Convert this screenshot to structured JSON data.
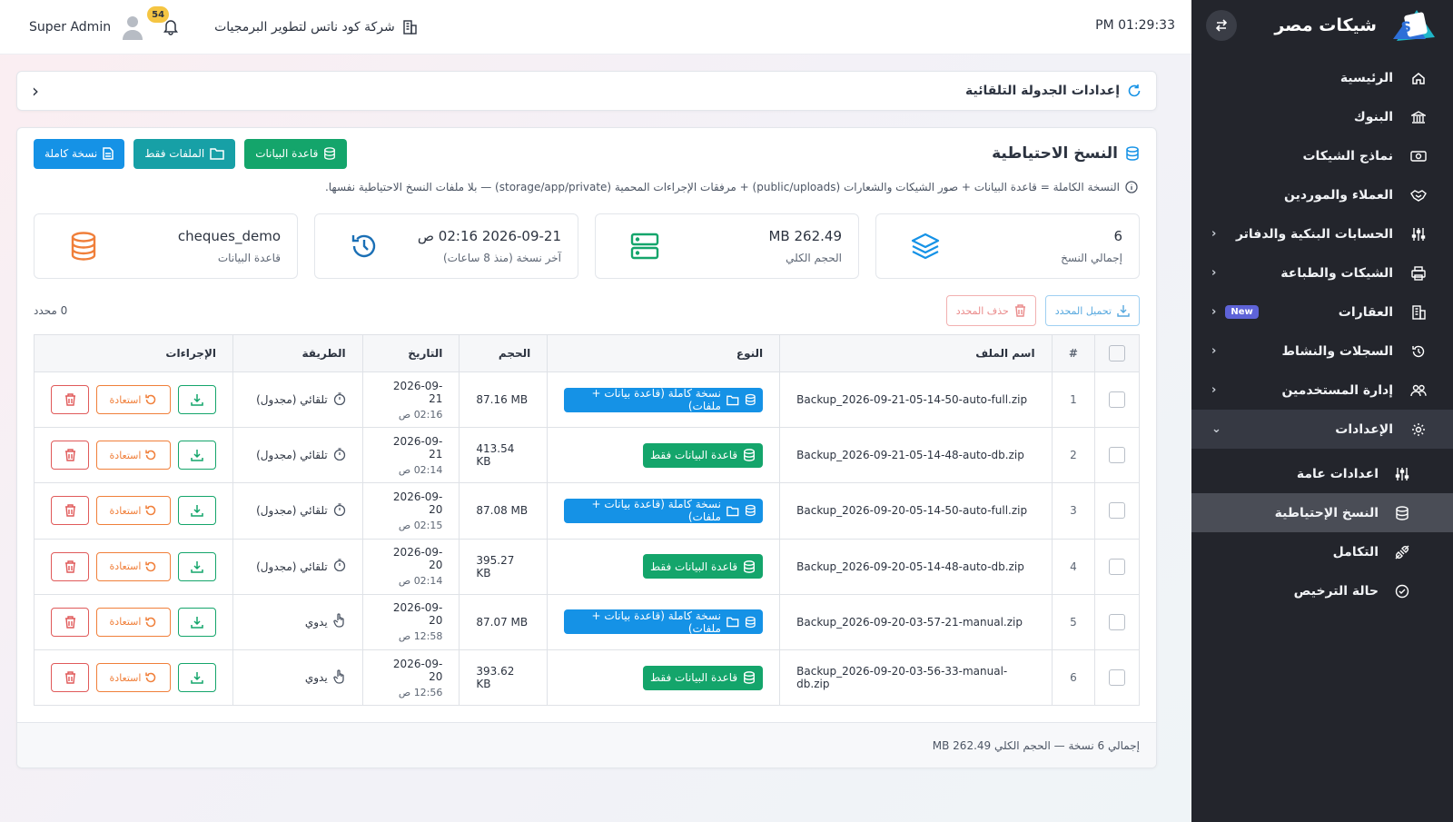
{
  "sidebar": {
    "brand_name": "شيكات مصر",
    "items": [
      {
        "label": "الرئيسية",
        "icon": "home-icon"
      },
      {
        "label": "البنوك",
        "icon": "bank-icon"
      },
      {
        "label": "نماذج الشيكات",
        "icon": "cash-icon"
      },
      {
        "label": "العملاء والموردين",
        "icon": "handshake-icon"
      },
      {
        "label": "الحسابات البنكية والدفاتر",
        "icon": "sliders-icon"
      },
      {
        "label": "الشيكات والطباعة",
        "icon": "printer-icon"
      },
      {
        "label": "العقارات",
        "icon": "building-icon",
        "badge": "New"
      },
      {
        "label": "السجلات والنشاط",
        "icon": "history-icon"
      },
      {
        "label": "إدارة المستخدمين",
        "icon": "users-icon"
      },
      {
        "label": "الإعدادات",
        "icon": "gear-icon"
      }
    ],
    "sub_items": [
      {
        "label": "اعدادات عامة",
        "icon": "sliders-icon"
      },
      {
        "label": "النسخ الإحتياطية",
        "icon": "database-icon"
      },
      {
        "label": "التكامل",
        "icon": "plug-icon"
      },
      {
        "label": "حالة الترخيص",
        "icon": "check-circle-icon"
      }
    ]
  },
  "topbar": {
    "time": "PM 01:29:33",
    "company": "شركة كود ناتس لتطوير البرمجيات",
    "notifications": "54",
    "user": "Super Admin"
  },
  "breadcrumb": {
    "title": "إعدادات الجدولة التلقائية"
  },
  "panel": {
    "title": "النسخ الاحتياطية",
    "buttons": {
      "db": "قاعدة البيانات",
      "files": "الملفات فقط",
      "full": "نسخة كاملة"
    },
    "info": "النسخة الكاملة = قاعدة البيانات + صور الشيكات والشعارات (public/uploads) + مرفقات الإجراءات المحمية (storage/app/private) — بلا ملفات النسخ الاحتياطية نفسها."
  },
  "stats": [
    {
      "value": "6",
      "label": "إجمالي النسخ",
      "icon": "layers-icon",
      "color": "#1592e6"
    },
    {
      "value": "262.49 MB",
      "label": "الحجم الكلي",
      "icon": "server-icon",
      "color": "#14a56b"
    },
    {
      "value": "2026-09-21 02:16 ص",
      "label": "آخر نسخة (منذ 8 ساعات)",
      "icon": "history-icon",
      "color": "#1a6fb5"
    },
    {
      "value": "cheques_demo",
      "label": "قاعدة البيانات",
      "icon": "database-icon",
      "color": "#f07f3a"
    }
  ],
  "bulk": {
    "download": "تحميل المحدد",
    "delete": "حذف المحدد",
    "selected": "0 محدد"
  },
  "table": {
    "headers": [
      "#",
      "اسم الملف",
      "النوع",
      "الحجم",
      "التاريخ",
      "الطريقة",
      "الإجراءات"
    ],
    "rows": [
      {
        "num": "1",
        "file": "Backup_2026-09-21-05-14-50-auto-full.zip",
        "type": "نسخة كاملة (قاعدة بيانات + ملفات)",
        "kind": "full",
        "size": "87.16 MB",
        "date": "2026-09-21",
        "time": "02:16 ص",
        "method": "تلقائي (مجدول)",
        "auto": true
      },
      {
        "num": "2",
        "file": "Backup_2026-09-21-05-14-48-auto-db.zip",
        "type": "قاعدة البيانات فقط",
        "kind": "db",
        "size": "413.54 KB",
        "date": "2026-09-21",
        "time": "02:14 ص",
        "method": "تلقائي (مجدول)",
        "auto": true
      },
      {
        "num": "3",
        "file": "Backup_2026-09-20-05-14-50-auto-full.zip",
        "type": "نسخة كاملة (قاعدة بيانات + ملفات)",
        "kind": "full",
        "size": "87.08 MB",
        "date": "2026-09-20",
        "time": "02:15 ص",
        "method": "تلقائي (مجدول)",
        "auto": true
      },
      {
        "num": "4",
        "file": "Backup_2026-09-20-05-14-48-auto-db.zip",
        "type": "قاعدة البيانات فقط",
        "kind": "db",
        "size": "395.27 KB",
        "date": "2026-09-20",
        "time": "02:14 ص",
        "method": "تلقائي (مجدول)",
        "auto": true
      },
      {
        "num": "5",
        "file": "Backup_2026-09-20-03-57-21-manual.zip",
        "type": "نسخة كاملة (قاعدة بيانات + ملفات)",
        "kind": "full",
        "size": "87.07 MB",
        "date": "2026-09-20",
        "time": "12:58 ص",
        "method": "يدوي",
        "auto": false
      },
      {
        "num": "6",
        "file": "Backup_2026-09-20-03-56-33-manual-db.zip",
        "type": "قاعدة البيانات فقط",
        "kind": "db",
        "size": "393.62 KB",
        "date": "2026-09-20",
        "time": "12:56 ص",
        "method": "يدوي",
        "auto": false
      }
    ],
    "restore_label": "استعادة"
  },
  "footer": {
    "summary": "إجمالي 6 نسخة — الحجم الكلي 262.49 MB"
  }
}
